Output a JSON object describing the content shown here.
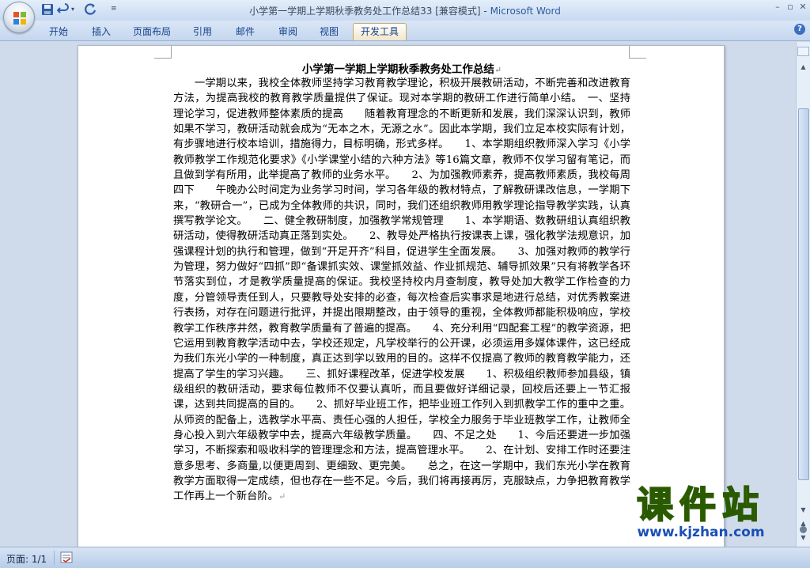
{
  "window": {
    "title": "小学第一学期上学期秋季教务处工作总结33 [兼容模式] - ",
    "app_name": "Microsoft Word",
    "controls": [
      "–",
      "▫",
      "✕"
    ]
  },
  "ribbon": {
    "tabs": [
      {
        "label": "开始"
      },
      {
        "label": "插入"
      },
      {
        "label": "页面布局"
      },
      {
        "label": "引用"
      },
      {
        "label": "邮件"
      },
      {
        "label": "审阅"
      },
      {
        "label": "视图"
      },
      {
        "label": "开发工具"
      }
    ],
    "active_tab": "开发工具"
  },
  "document": {
    "title": "小学第一学期上学期秋季教务处工作总结",
    "paragraph_mark": "↵",
    "body": "　　一学期以来，我校全体教师坚持学习教育教学理论，积极开展教研活动，不断完善和改进教育方法，为提高我校的教育教学质量提供了保证。现对本学期的教研工作进行简单小结。　一、坚持理论学习，促进教师整体素质的提高　　随着教育理念的不断更新和发展，我们深深认识到，教师如果不学习，教研活动就会成为“无本之木，无源之水”。因此本学期，我们立足本校实际有计划，有步骤地进行校本培训，措施得力，目标明确，形式多样。　　1、本学期组织教师深入学习《小学教师教学工作规范化要求》《小学课堂小结的六种方法》等16篇文章，教师不仅学习留有笔记，而且做到学有所用，此举提高了教师的业务水平。　　2、为加强教师素养，提高教师素质，我校每周四下　　午晚办公时间定为业务学习时间，学习各年级的教材特点，了解教研课改信息，一学期下来，“教研合一”，已成为全体教师的共识，同时，我们还组织教师用教学理论指导教学实践，认真撰写教学论文。　　二、健全教研制度，加强教学常规管理　　1、本学期语、数教研组认真组织教研活动，使得教研活动真正落到实处。　　2、教导处严格执行按课表上课，强化教学法规意识，加强课程计划的执行和管理，做到“开足开齐”科目，促进学生全面发展。　　3、加强对教师的教学行为管理，努力做好“四抓”即“备课抓实效、课堂抓效益、作业抓规范、辅导抓效果”只有将教学各环节落实到位，才是教学质量提高的保证。我校坚持校内月查制度，教导处加大教学工作检查的力度，分管领导责任到人，只要教导处安排的必查，每次检查后实事求是地进行总结，对优秀教案进行表扬，对存在问题进行批评，并提出限期整改，由于领导的重视，全体教师都能积极响应，学校教学工作秩序井然，教育教学质量有了普遍的提高。　　4、充分利用“四配套工程”的教学资源，把它运用到教育教学活动中去，学校还规定，凡学校举行的公开课，必须运用多媒体课件，这已经成为我们东光小学的一种制度，真正达到学以致用的目的。这样不仅提高了教师的教育教学能力，还提高了学生的学习兴趣。　　三、抓好课程改革，促进学校发展　　1、积极组织教师参加县级，镇级组织的教研活动，要求每位教师不仅要认真听，而且要做好详细记录，回校后还要上一节汇报课，达到共同提高的目的。　　2、抓好毕业班工作，把毕业班工作列入到抓教学工作的重中之重。从师资的配备上，选教学水平高、责任心强的人担任，学校全力服务于毕业班教学工作，让教师全身心投入到六年级教学中去，提高六年级教学质量。　　四、不足之处　　1、今后还要进一步加强学习，不断探索和吸收科学的管理理念和方法，提高管理水平。　　2、在计划、安排工作时还要注意多思考、多商量,以便更周到、更细致、更完美。　　总之，在这一学期中，我们东光小学在教育教学方面取得一定成绩，但也存在一些不足。今后，我们将再接再厉，克服缺点，力争把教育教学工作再上一个新台阶。"
  },
  "watermark": {
    "main": "课件站",
    "url": "www.kjzhan.com"
  },
  "statusbar": {
    "page_count": "页面: 1/1"
  },
  "icons": {
    "office": "office-logo-icon",
    "save": "save-icon",
    "undo": "undo-icon",
    "redo": "redo-icon",
    "help": "help-icon"
  }
}
